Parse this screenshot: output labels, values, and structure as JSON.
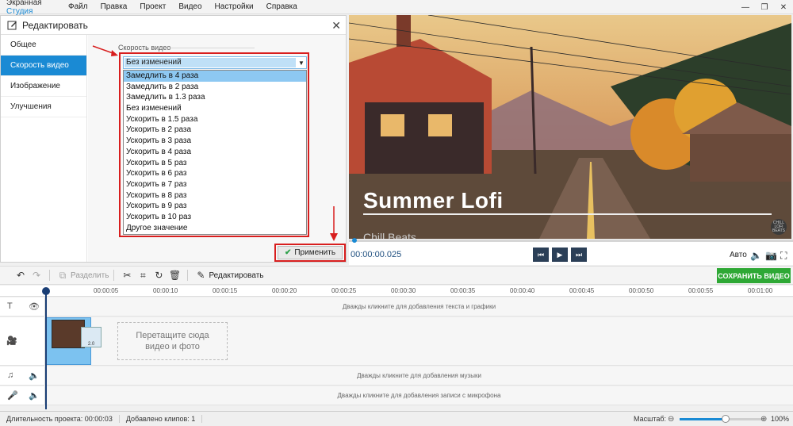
{
  "app": {
    "title_main": "Экранная ",
    "title_accent": "Студия"
  },
  "menu": [
    "Файл",
    "Правка",
    "Проект",
    "Видео",
    "Настройки",
    "Справка"
  ],
  "window_controls": {
    "minimize": "—",
    "maximize": "❐",
    "close": "✕"
  },
  "edit_panel": {
    "title": "Редактировать",
    "close": "✕",
    "nav": [
      "Общее",
      "Скорость видео",
      "Изображение",
      "Улучшения"
    ],
    "active_nav_index": 1,
    "group_label": "Скорость видео",
    "select_value": "Без изменений",
    "select_arrow": "▼",
    "options": [
      "Замедлить в 4 раза",
      "Замедлить в 2 раза",
      "Замедлить в 1.3 раза",
      "Без изменений",
      "Ускорить в 1.5 раза",
      "Ускорить в 2 раза",
      "Ускорить в 3 раза",
      "Ускорить в 4 раза",
      "Ускорить в 5 раз",
      "Ускорить в 6 раз",
      "Ускорить в 7 раз",
      "Ускорить в 8 раз",
      "Ускорить в 9 раз",
      "Ускорить в 10 раз",
      "Другое значение"
    ],
    "highlighted_option_index": 0,
    "apply_label": "Применить"
  },
  "preview": {
    "title": "Summer Lofi",
    "subtitle": "Chill Beats",
    "badge": "CHILL LOFI BEATS"
  },
  "playback": {
    "time": "00:00:00.025",
    "progress": 0,
    "quality": "Авто",
    "buttons": {
      "prev": "⏮",
      "play": "▶",
      "next": "⏭"
    }
  },
  "toolbar": {
    "split_label": "Разделить",
    "edit_label": "Редактировать",
    "save_label": "СОХРАНИТЬ ВИДЕО"
  },
  "ruler": [
    "00:00:05",
    "00:00:10",
    "00:00:15",
    "00:00:20",
    "00:00:25",
    "00:00:30",
    "00:00:35",
    "00:00:40",
    "00:00:45",
    "00:00:50",
    "00:00:55",
    "00:01:00"
  ],
  "tracks": {
    "text_hint": "Дважды кликните для добавления текста и графики",
    "drop_zone_line1": "Перетащите сюда",
    "drop_zone_line2": "видео и фото",
    "clip_badge": "2.0",
    "music_hint": "Дважды кликните для добавления музыки",
    "mic_hint": "Дважды кликните для добавления записи с микрофона"
  },
  "status": {
    "duration": "Длительность проекта:  00:00:03",
    "clips": "Добавлено клипов: 1",
    "zoom_label": "Масштаб:",
    "zoom_value": "100%",
    "zoom_level": 0.55
  },
  "colors": {
    "accent": "#1a8ad4",
    "save": "#2ea835",
    "annotation": "#d81e1e"
  }
}
